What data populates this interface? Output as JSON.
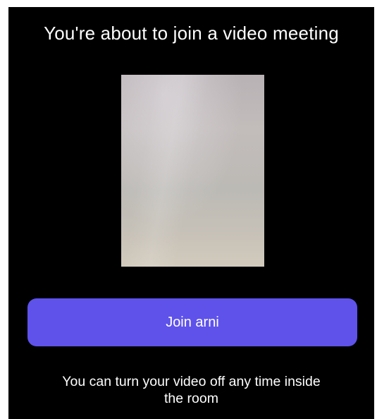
{
  "header": {
    "title": "You're about to join a video meeting"
  },
  "preview": {
    "icon": "camera-preview"
  },
  "actions": {
    "join_label": "Join arni"
  },
  "footer": {
    "hint_line1": "You can turn your video off any time inside",
    "hint_line2": "the room"
  },
  "colors": {
    "background": "#000000",
    "button": "#5e52eb",
    "text": "#ffffff"
  }
}
